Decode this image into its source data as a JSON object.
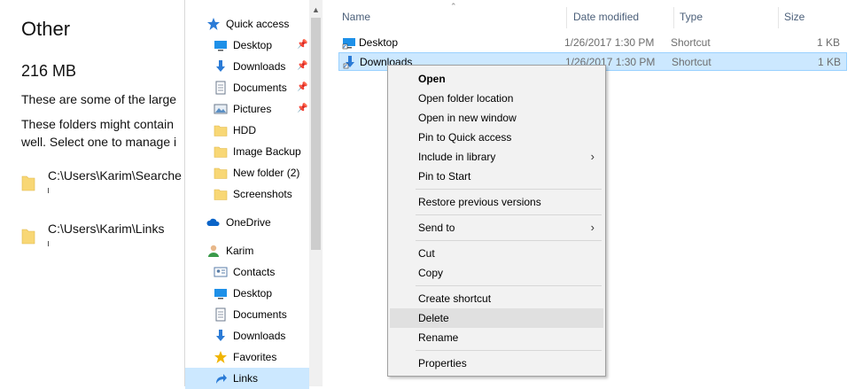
{
  "settings": {
    "title": "Other",
    "size": "216 MB",
    "para1": "These are some of the large",
    "para2a": "These folders might contain",
    "para2b": "well. Select one to manage i",
    "folders": [
      {
        "path": "C:\\Users\\Karim\\Searche"
      },
      {
        "path": "C:\\Users\\Karim\\Links"
      }
    ]
  },
  "navigation": {
    "items": [
      {
        "label": "Quick access",
        "icon": "star-icon"
      },
      {
        "label": "Desktop",
        "icon": "desktop-icon",
        "pinned": true
      },
      {
        "label": "Downloads",
        "icon": "download-arrow-icon",
        "pinned": true
      },
      {
        "label": "Documents",
        "icon": "document-icon",
        "pinned": true
      },
      {
        "label": "Pictures",
        "icon": "pictures-icon",
        "pinned": true
      },
      {
        "label": "HDD",
        "icon": "folder-icon"
      },
      {
        "label": "Image Backup",
        "icon": "folder-icon"
      },
      {
        "label": "New folder (2)",
        "icon": "folder-icon"
      },
      {
        "label": "Screenshots",
        "icon": "folder-icon"
      },
      {
        "label": "OneDrive",
        "icon": "cloud-icon"
      },
      {
        "label": "Karim",
        "icon": "user-icon"
      },
      {
        "label": "Contacts",
        "icon": "contacts-icon"
      },
      {
        "label": "Desktop",
        "icon": "desktop-icon"
      },
      {
        "label": "Documents",
        "icon": "document-icon"
      },
      {
        "label": "Downloads",
        "icon": "download-arrow-icon"
      },
      {
        "label": "Favorites",
        "icon": "star-icon"
      },
      {
        "label": "Links",
        "icon": "link-arrow-icon"
      }
    ]
  },
  "filelist": {
    "columns": {
      "name": "Name",
      "date": "Date modified",
      "type": "Type",
      "size": "Size"
    },
    "rows": [
      {
        "name": "Desktop",
        "date": "1/26/2017 1:30 PM",
        "type": "Shortcut",
        "size": "1 KB"
      },
      {
        "name": "Downloads",
        "date": "1/26/2017 1:30 PM",
        "type": "Shortcut",
        "size": "1 KB"
      }
    ]
  },
  "context_menu": {
    "open": "Open",
    "open_folder_location": "Open folder location",
    "open_new_window": "Open in new window",
    "pin_quick_access": "Pin to Quick access",
    "include_library": "Include in library",
    "pin_start": "Pin to Start",
    "restore_versions": "Restore previous versions",
    "send_to": "Send to",
    "cut": "Cut",
    "copy": "Copy",
    "create_shortcut": "Create shortcut",
    "delete": "Delete",
    "rename": "Rename",
    "properties": "Properties"
  },
  "colors": {
    "selection": "#cce8ff",
    "selection_border": "#99d1ff",
    "menu_bg": "#f2f2f2",
    "menu_hover": "#e0e0e0",
    "folder_yellow": "#f8d775",
    "header_text": "#4c607a"
  }
}
